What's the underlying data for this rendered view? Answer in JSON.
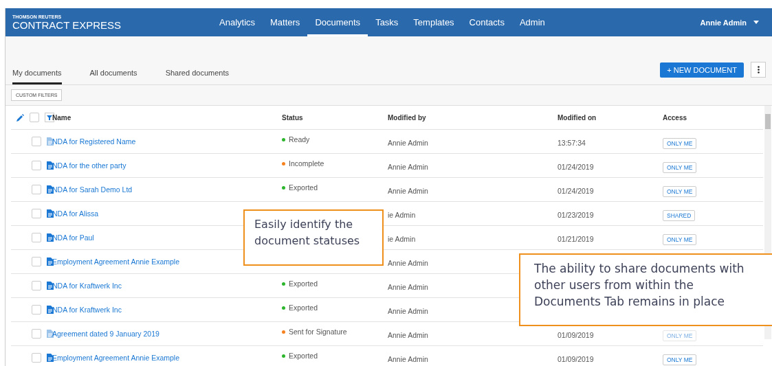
{
  "brand": {
    "company": "THOMSON REUTERS",
    "product": "CONTRACT EXPRESS"
  },
  "nav": [
    {
      "label": "Analytics",
      "selected": false
    },
    {
      "label": "Matters",
      "selected": false
    },
    {
      "label": "Documents",
      "selected": true
    },
    {
      "label": "Tasks",
      "selected": false
    },
    {
      "label": "Templates",
      "selected": false
    },
    {
      "label": "Contacts",
      "selected": false
    },
    {
      "label": "Admin",
      "selected": false
    }
  ],
  "user": "Annie Admin",
  "tabs": [
    {
      "label": "My documents",
      "selected": true
    },
    {
      "label": "All documents",
      "selected": false
    },
    {
      "label": "Shared documents",
      "selected": false
    }
  ],
  "new_button": "+ NEW DOCUMENT",
  "custom_filters": "CUSTOM FILTERS",
  "select_all_checked": false,
  "columns": [
    "Name",
    "Status",
    "Modified by",
    "Modified on",
    "Access"
  ],
  "rows": [
    {
      "name": "NDA for Registered Name",
      "icon_faded": true,
      "checked": false,
      "status": "Ready",
      "color": "#2db52d",
      "modified_by": "Annie Admin",
      "modified_on": "13:57:34",
      "access": "ONLY ME"
    },
    {
      "name": "NDA for the other party",
      "icon_faded": false,
      "checked": false,
      "status": "Incomplete",
      "color": "#f5821f",
      "modified_by": "Annie Admin",
      "modified_on": "01/24/2019",
      "access": "ONLY ME"
    },
    {
      "name": "NDA for Sarah Demo Ltd",
      "icon_faded": false,
      "checked": false,
      "status": "Exported",
      "color": "#2db52d",
      "modified_by": "Annie Admin",
      "modified_on": "01/24/2019",
      "access": "ONLY ME"
    },
    {
      "name": "NDA for Alissa",
      "icon_faded": false,
      "checked": false,
      "modified_by": "ie Admin",
      "modified_on": "01/23/2019",
      "access": "SHARED"
    },
    {
      "name": "NDA for Paul",
      "icon_faded": false,
      "checked": false,
      "modified_by": "ie Admin",
      "modified_on": "01/21/2019",
      "access": "ONLY ME"
    },
    {
      "name": "Employment Agreement Annie Example",
      "icon_faded": false,
      "checked": false,
      "modified_by": "Annie Admin"
    },
    {
      "name": "NDA for Kraftwerk Inc",
      "icon_faded": false,
      "checked": false,
      "status": "Exported",
      "color": "#2db52d",
      "modified_by": "Annie Admin"
    },
    {
      "name": "NDA for Kraftwerk Inc",
      "icon_faded": false,
      "checked": false,
      "status": "Exported",
      "color": "#2db52d",
      "modified_by": "Annie Admin"
    },
    {
      "name": "Agreement dated 9 January 2019",
      "icon_faded": true,
      "checked": false,
      "status": "Sent for Signature",
      "color": "#f5821f",
      "modified_by": "Annie Admin",
      "modified_on": "01/09/2019",
      "access": "ONLY ME",
      "access_faded": true
    },
    {
      "name": "Employment Agreement Annie Example",
      "icon_faded": false,
      "checked": false,
      "status": "Exported",
      "color": "#2db52d",
      "modified_by": "Annie Admin",
      "modified_on": "01/09/2019",
      "access": "ONLY ME"
    }
  ],
  "callouts": [
    {
      "text": "Easily identify the document statuses"
    },
    {
      "text": "The ability to share documents with other users from within the Documents Tab remains in place"
    }
  ]
}
